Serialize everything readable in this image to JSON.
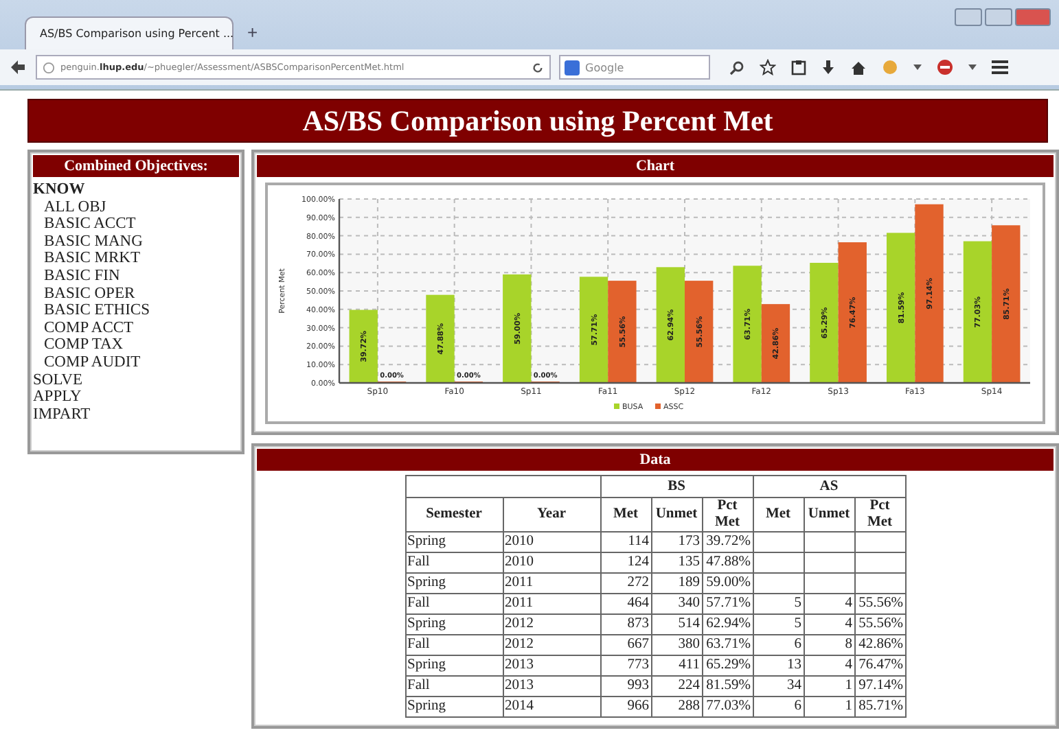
{
  "browser": {
    "tab_title": "AS/BS Comparison using Percent ...",
    "new_tab": "+",
    "url": "penguin.**lhup.edu**/~phuegler/Assessment/ASBSComparisonPercentMet.html",
    "search_placeholder": "Google"
  },
  "page_title": "AS/BS Comparison using Percent Met",
  "sidebar": {
    "title": "Combined Objectives:",
    "items": [
      {
        "label": "KNOW",
        "expanded": true,
        "children": [
          {
            "label": "ALL OBJ"
          },
          {
            "label": "BASIC ACCT"
          },
          {
            "label": "BASIC MANG"
          },
          {
            "label": "BASIC MRKT"
          },
          {
            "label": "BASIC FIN"
          },
          {
            "label": "BASIC OPER"
          },
          {
            "label": "BASIC ETHICS"
          },
          {
            "label": "COMP ACCT"
          },
          {
            "label": "COMP TAX"
          },
          {
            "label": "COMP AUDIT"
          }
        ]
      },
      {
        "label": "SOLVE",
        "expanded": false
      },
      {
        "label": "APPLY",
        "expanded": false
      },
      {
        "label": "IMPART",
        "expanded": false
      }
    ]
  },
  "chart_panel": {
    "title": "Chart",
    "chart_data": {
      "type": "bar",
      "ylabel": "Percent Met",
      "categories": [
        "Sp10",
        "Fa10",
        "Sp11",
        "Fa11",
        "Sp12",
        "Fa12",
        "Sp13",
        "Fa13",
        "Sp14"
      ],
      "series": [
        {
          "name": "BUSA",
          "color": "#a8d42a",
          "values": [
            39.72,
            47.88,
            59.0,
            57.71,
            62.94,
            63.71,
            65.29,
            81.59,
            77.03
          ],
          "value_labels": [
            "39.72%",
            "47.88%",
            "59.00%",
            "57.71%",
            "62.94%",
            "63.71%",
            "65.29%",
            "81.59%",
            "77.03%"
          ]
        },
        {
          "name": "ASSC",
          "color": "#e2622d",
          "values": [
            0,
            0,
            0,
            55.56,
            55.56,
            42.86,
            76.47,
            97.14,
            85.71
          ],
          "value_labels": [
            "0.00%",
            "0.00%",
            "0.00%",
            "55.56%",
            "55.56%",
            "42.86%",
            "76.47%",
            "97.14%",
            "85.71%"
          ]
        }
      ],
      "grid": true,
      "legend": true,
      "ylim": [
        0,
        100
      ],
      "yticks": [
        {
          "value": 0,
          "label": "0.00%"
        },
        {
          "value": 10,
          "label": "10.00%"
        },
        {
          "value": 20,
          "label": "20.00%"
        },
        {
          "value": 30,
          "label": "30.00%"
        },
        {
          "value": 40,
          "label": "40.00%"
        },
        {
          "value": 50,
          "label": "50.00%"
        },
        {
          "value": 60,
          "label": "60.00%"
        },
        {
          "value": 70,
          "label": "70.00%"
        },
        {
          "value": 80,
          "label": "80.00%"
        },
        {
          "value": 90,
          "label": "90.00%"
        },
        {
          "value": 100,
          "label": "100.00%"
        }
      ],
      "stacked": false
    }
  },
  "data_panel": {
    "title": "Data",
    "groups": [
      "BS",
      "AS"
    ],
    "columns": [
      "Semester",
      "Year",
      "Met",
      "Unmet",
      "Pct Met",
      "Met",
      "Unmet",
      "Pct Met"
    ],
    "rows": [
      {
        "semester": "Spring",
        "year": "2010",
        "bs": [
          "114",
          "173",
          "39.72%"
        ]
      },
      {
        "semester": "Fall",
        "year": "2010",
        "bs": [
          "124",
          "135",
          "47.88%"
        ]
      },
      {
        "semester": "Spring",
        "year": "2011",
        "bs": [
          "272",
          "189",
          "59.00%"
        ]
      },
      {
        "semester": "Fall",
        "year": "2011",
        "bs": [
          "464",
          "340",
          "57.71%"
        ],
        "as": [
          "5",
          "4",
          "55.56%"
        ]
      },
      {
        "semester": "Spring",
        "year": "2012",
        "bs": [
          "873",
          "514",
          "62.94%"
        ],
        "as": [
          "5",
          "4",
          "55.56%"
        ]
      },
      {
        "semester": "Fall",
        "year": "2012",
        "bs": [
          "667",
          "380",
          "63.71%"
        ],
        "as": [
          "6",
          "8",
          "42.86%"
        ]
      },
      {
        "semester": "Spring",
        "year": "2013",
        "bs": [
          "773",
          "411",
          "65.29%"
        ],
        "as": [
          "13",
          "4",
          "76.47%"
        ]
      },
      {
        "semester": "Fall",
        "year": "2013",
        "bs": [
          "993",
          "224",
          "81.59%"
        ],
        "as": [
          "34",
          "1",
          "97.14%"
        ]
      },
      {
        "semester": "Spring",
        "year": "2014",
        "bs": [
          "966",
          "288",
          "77.03%"
        ],
        "as": [
          "6",
          "1",
          "85.71%"
        ]
      }
    ]
  }
}
